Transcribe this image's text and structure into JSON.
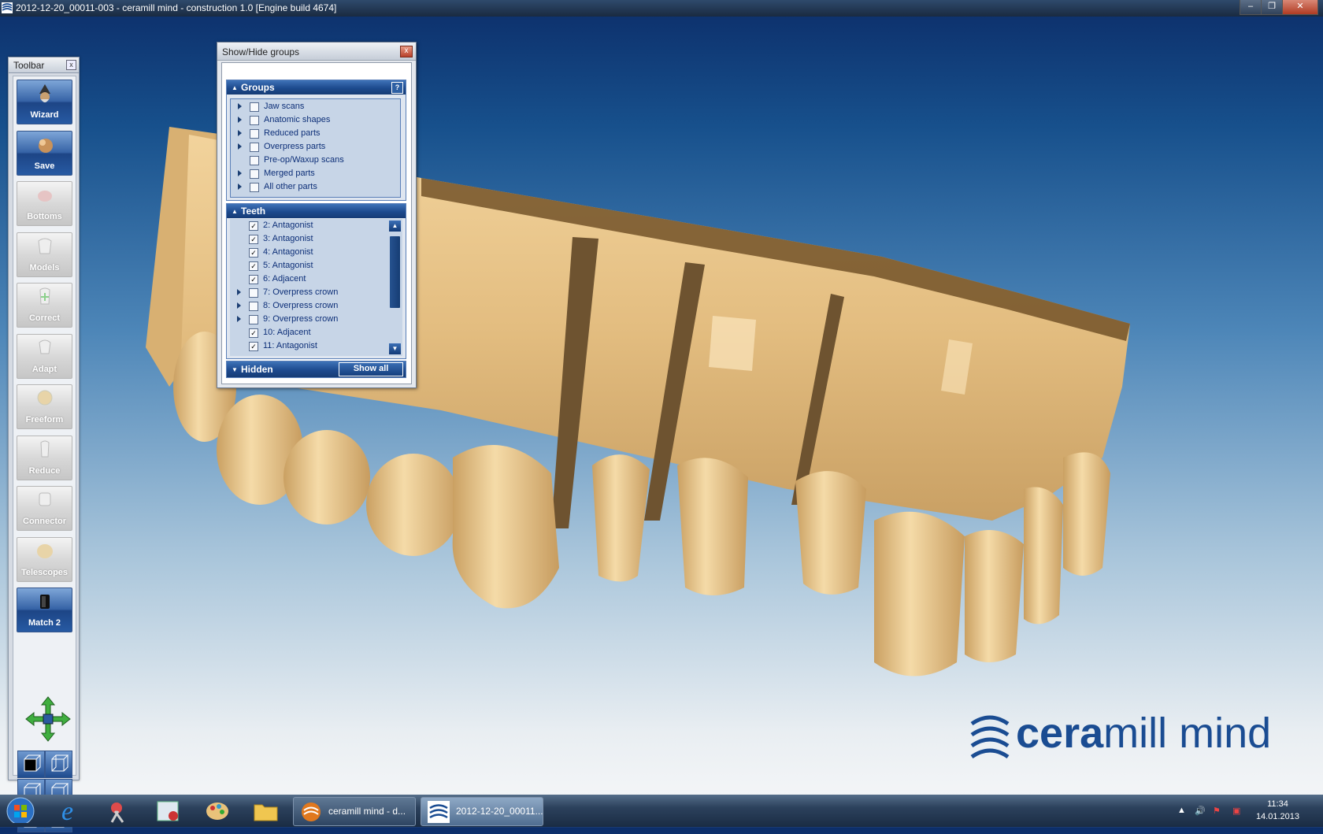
{
  "window": {
    "title": "2012-12-20_00011-003 - ceramill mind - construction 1.0 [Engine build 4674]",
    "minimize": "–",
    "maximize": "❐",
    "close": "✕"
  },
  "toolbar": {
    "title": "Toolbar",
    "close": "x",
    "buttons": [
      {
        "label": "Wizard",
        "active": true,
        "icon": "wizard-icon"
      },
      {
        "label": "Save",
        "active": true,
        "icon": "save-icon"
      },
      {
        "label": "Bottoms",
        "active": false,
        "icon": "bottoms-icon"
      },
      {
        "label": "Models",
        "active": false,
        "icon": "models-icon"
      },
      {
        "label": "Correct",
        "active": false,
        "icon": "correct-icon"
      },
      {
        "label": "Adapt",
        "active": false,
        "icon": "adapt-icon"
      },
      {
        "label": "Freeform",
        "active": false,
        "icon": "freeform-icon"
      },
      {
        "label": "Reduce",
        "active": false,
        "icon": "reduce-icon"
      },
      {
        "label": "Connector",
        "active": false,
        "icon": "connector-icon"
      },
      {
        "label": "Telescopes",
        "active": false,
        "icon": "telescopes-icon"
      },
      {
        "label": "Match 2",
        "active": true,
        "icon": "match-icon"
      }
    ]
  },
  "dialog": {
    "title": "Show/Hide groups",
    "close": "x",
    "groups": {
      "title": "Groups",
      "help": "?",
      "items": [
        {
          "label": "Jaw scans",
          "expandable": true,
          "checked": false
        },
        {
          "label": "Anatomic shapes",
          "expandable": true,
          "checked": false
        },
        {
          "label": "Reduced parts",
          "expandable": true,
          "checked": false
        },
        {
          "label": "Overpress parts",
          "expandable": true,
          "checked": false
        },
        {
          "label": "Pre-op/Waxup scans",
          "expandable": false,
          "checked": false
        },
        {
          "label": "Merged parts",
          "expandable": true,
          "checked": false
        },
        {
          "label": "All other parts",
          "expandable": true,
          "checked": false
        }
      ]
    },
    "teeth": {
      "title": "Teeth",
      "items": [
        {
          "label": "2: Antagonist",
          "expandable": false,
          "checked": true
        },
        {
          "label": "3: Antagonist",
          "expandable": false,
          "checked": true
        },
        {
          "label": "4: Antagonist",
          "expandable": false,
          "checked": true
        },
        {
          "label": "5: Antagonist",
          "expandable": false,
          "checked": true
        },
        {
          "label": "6: Adjacent",
          "expandable": false,
          "checked": true
        },
        {
          "label": "7: Overpress crown",
          "expandable": true,
          "checked": false
        },
        {
          "label": "8: Overpress crown",
          "expandable": true,
          "checked": false
        },
        {
          "label": "9: Overpress crown",
          "expandable": true,
          "checked": false
        },
        {
          "label": "10: Adjacent",
          "expandable": false,
          "checked": true
        },
        {
          "label": "11: Antagonist",
          "expandable": false,
          "checked": true
        }
      ]
    },
    "hidden": {
      "title": "Hidden",
      "show_all": "Show all"
    }
  },
  "watermark": {
    "brand_bold": "cera",
    "brand_rest": "mill mind"
  },
  "taskbar": {
    "tasks": [
      {
        "label": "ceramill mind - d...",
        "active": false
      },
      {
        "label": "2012-12-20_00011...",
        "active": true
      }
    ],
    "time": "11:34",
    "date": "14.01.2013"
  },
  "colors": {
    "accent": "#1d4a8e",
    "model": "#e8c48a",
    "list_text": "#0d2f78"
  }
}
